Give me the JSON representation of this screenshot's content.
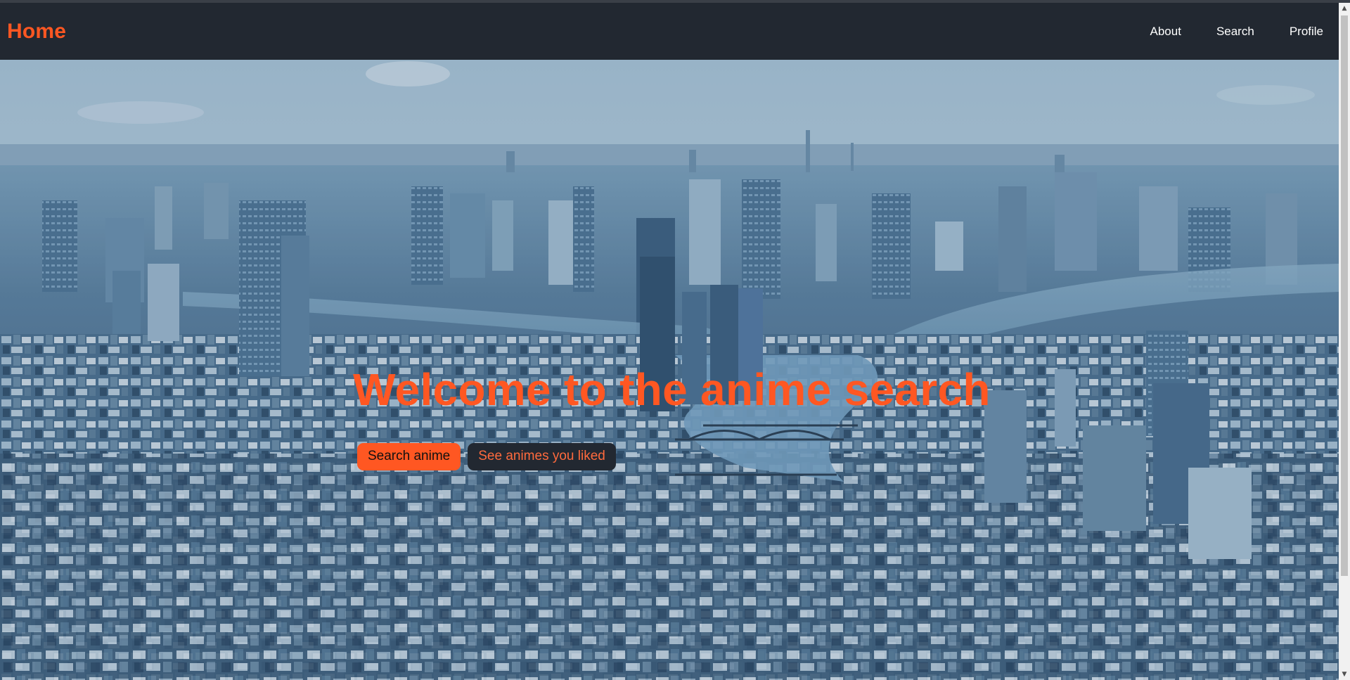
{
  "navbar": {
    "brand": "Home",
    "links": [
      "About",
      "Search",
      "Profile"
    ]
  },
  "hero": {
    "title": "Welcome to the anime search",
    "buttons": {
      "primary": "Search anime",
      "secondary": "See animes you liked"
    },
    "background": "aerial city skyline with river and bridges (blue tint)"
  },
  "colors": {
    "accent": "#ff5722",
    "navbar": "#222831",
    "nav_text": "#ffffff"
  },
  "icons": {
    "scroll_up": "▲",
    "scroll_down": "▼"
  }
}
